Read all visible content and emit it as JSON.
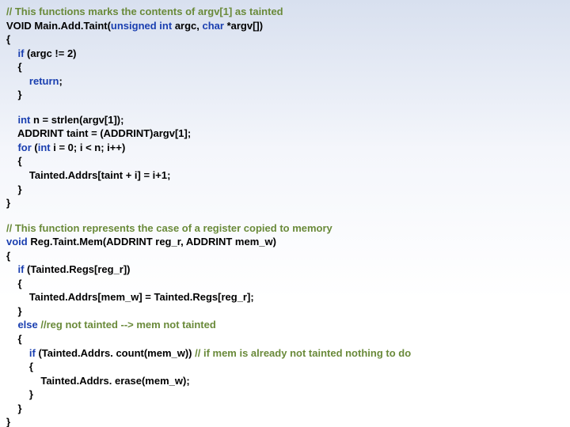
{
  "blocks": [
    {
      "lines": [
        {
          "segs": [
            {
              "t": "// This functions marks the contents of argv[1] as tainted",
              "c": "cm"
            }
          ]
        },
        {
          "segs": [
            {
              "t": "VOID Main.Add.Taint("
            },
            {
              "t": "unsigned int",
              "c": "kw"
            },
            {
              "t": " argc, "
            },
            {
              "t": "char",
              "c": "kw"
            },
            {
              "t": " *argv[])"
            }
          ]
        },
        {
          "segs": [
            {
              "t": "{"
            }
          ]
        },
        {
          "segs": [
            {
              "t": "    "
            },
            {
              "t": "if",
              "c": "kw"
            },
            {
              "t": " (argc != 2)"
            }
          ]
        },
        {
          "segs": [
            {
              "t": "    {"
            }
          ]
        },
        {
          "segs": [
            {
              "t": "        "
            },
            {
              "t": "return",
              "c": "kw"
            },
            {
              "t": ";"
            }
          ]
        },
        {
          "segs": [
            {
              "t": "    }"
            }
          ]
        }
      ]
    },
    {
      "lines": [
        {
          "segs": [
            {
              "t": "    "
            },
            {
              "t": "int",
              "c": "kw"
            },
            {
              "t": " n = strlen(argv[1]);"
            }
          ]
        },
        {
          "segs": [
            {
              "t": "    ADDRINT taint = (ADDRINT)argv[1];"
            }
          ]
        },
        {
          "segs": [
            {
              "t": "    "
            },
            {
              "t": "for",
              "c": "kw"
            },
            {
              "t": " ("
            },
            {
              "t": "int",
              "c": "kw"
            },
            {
              "t": " i = 0; i < n; i++)"
            }
          ]
        },
        {
          "segs": [
            {
              "t": "    {"
            }
          ]
        },
        {
          "segs": [
            {
              "t": "        Tainted.Addrs[taint + i] = i+1;"
            }
          ]
        },
        {
          "segs": [
            {
              "t": "    }"
            }
          ]
        },
        {
          "segs": [
            {
              "t": "}"
            }
          ]
        }
      ]
    },
    {
      "lines": [
        {
          "segs": [
            {
              "t": "// This function represents the case of a register copied to memory",
              "c": "cm"
            }
          ]
        },
        {
          "segs": [
            {
              "t": "void",
              "c": "kw"
            },
            {
              "t": " Reg.Taint.Mem(ADDRINT reg_r, ADDRINT mem_w)"
            }
          ]
        },
        {
          "segs": [
            {
              "t": "{"
            }
          ]
        },
        {
          "segs": [
            {
              "t": "    "
            },
            {
              "t": "if",
              "c": "kw"
            },
            {
              "t": " (Tainted.Regs[reg_r])"
            }
          ]
        },
        {
          "segs": [
            {
              "t": "    {"
            }
          ]
        },
        {
          "segs": [
            {
              "t": "        Tainted.Addrs[mem_w] = Tainted.Regs[reg_r];"
            }
          ]
        },
        {
          "segs": [
            {
              "t": "    }"
            }
          ]
        },
        {
          "segs": [
            {
              "t": "    "
            },
            {
              "t": "else",
              "c": "kw"
            },
            {
              "t": " "
            },
            {
              "t": "//reg not tainted --> mem not tainted",
              "c": "cm"
            }
          ]
        },
        {
          "segs": [
            {
              "t": "    {"
            }
          ]
        },
        {
          "segs": [
            {
              "t": "        "
            },
            {
              "t": "if",
              "c": "kw"
            },
            {
              "t": " (Tainted.Addrs. count(mem_w)) "
            },
            {
              "t": "// if mem is already not tainted nothing to do",
              "c": "cm"
            }
          ]
        },
        {
          "segs": [
            {
              "t": "        {"
            }
          ]
        },
        {
          "segs": [
            {
              "t": "            Tainted.Addrs. erase(mem_w);"
            }
          ]
        },
        {
          "segs": [
            {
              "t": "        }"
            }
          ]
        },
        {
          "segs": [
            {
              "t": "    }"
            }
          ]
        },
        {
          "segs": [
            {
              "t": "}"
            }
          ]
        }
      ]
    }
  ]
}
